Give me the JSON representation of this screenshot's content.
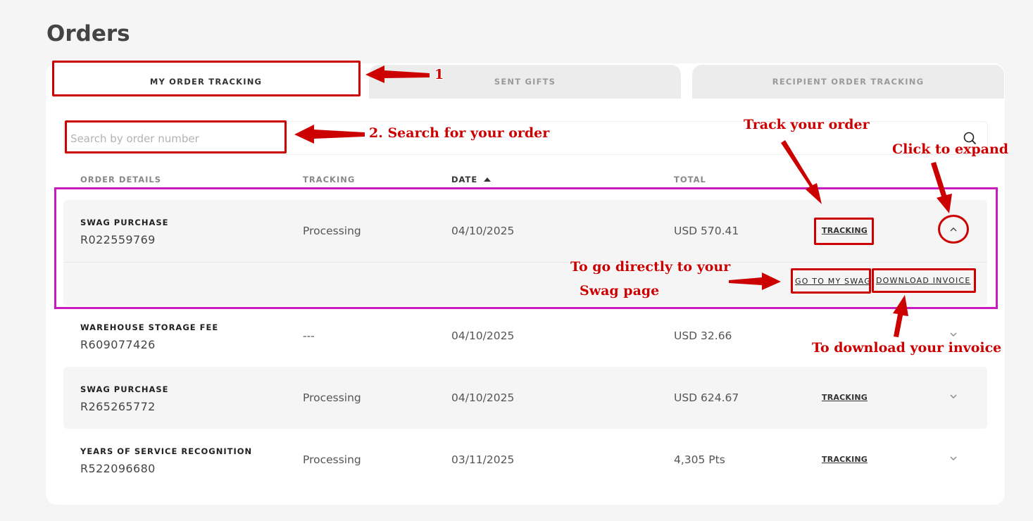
{
  "page": {
    "title": "Orders"
  },
  "tabs": [
    {
      "label": "MY ORDER TRACKING",
      "active": true
    },
    {
      "label": "SENT GIFTS",
      "active": false
    },
    {
      "label": "RECIPIENT ORDER TRACKING",
      "active": false
    }
  ],
  "search": {
    "placeholder": "Search by order number",
    "icon": "search-icon"
  },
  "table": {
    "headers": {
      "details": "ORDER DETAILS",
      "tracking": "TRACKING",
      "date": "DATE",
      "total": "TOTAL"
    },
    "sort": {
      "column": "date",
      "direction": "ascending"
    },
    "rows": [
      {
        "type": "SWAG PURCHASE",
        "number": "R022559769",
        "tracking": "Processing",
        "date": "04/10/2025",
        "total": "USD 570.41",
        "link": "TRACKING",
        "expanded": true,
        "actions": {
          "swag": "GO TO MY SWAG",
          "invoice": "DOWNLOAD INVOICE"
        }
      },
      {
        "type": "WAREHOUSE STORAGE FEE",
        "number": "R609077426",
        "tracking": "---",
        "date": "04/10/2025",
        "total": "USD 32.66",
        "link": "",
        "expanded": false
      },
      {
        "type": "SWAG PURCHASE",
        "number": "R265265772",
        "tracking": "Processing",
        "date": "04/10/2025",
        "total": "USD 624.67",
        "link": "TRACKING",
        "expanded": false
      },
      {
        "type": "YEARS OF SERVICE RECOGNITION",
        "number": "R522096680",
        "tracking": "Processing",
        "date": "03/11/2025",
        "total": "4,305 Pts",
        "link": "TRACKING",
        "expanded": false
      }
    ]
  },
  "annotations": {
    "step1": "1",
    "step2": "2. Search for your order",
    "track": "Track your order",
    "expand": "Click to expand",
    "swag_line1": "To go directly to your",
    "swag_line2": "Swag page",
    "invoice": "To download your invoice"
  },
  "colors": {
    "annotation": "#cc0000",
    "expanded_highlight": "#c81cbe",
    "row_background": "#f5f5f5"
  }
}
